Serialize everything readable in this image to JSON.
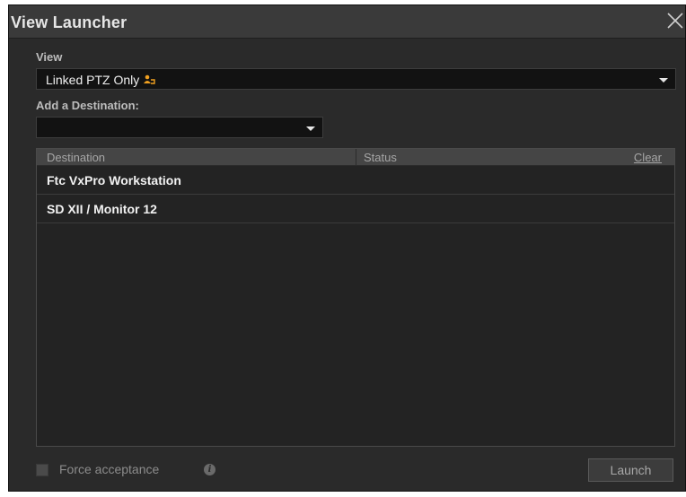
{
  "window": {
    "title": "View Launcher"
  },
  "view": {
    "label": "View",
    "selected": "Linked PTZ Only",
    "icon": "ptz-linked-icon",
    "icon_color": "#f0a020"
  },
  "destination_picker": {
    "label": "Add a Destination:",
    "selected": ""
  },
  "table": {
    "columns": [
      "Destination",
      "Status"
    ],
    "clear_label": "Clear",
    "rows": [
      {
        "destination": "Ftc VxPro Workstation",
        "status": ""
      },
      {
        "destination": "SD XII / Monitor 12",
        "status": ""
      }
    ]
  },
  "footer": {
    "force_label": "Force acceptance",
    "force_checked": false,
    "launch_label": "Launch"
  }
}
